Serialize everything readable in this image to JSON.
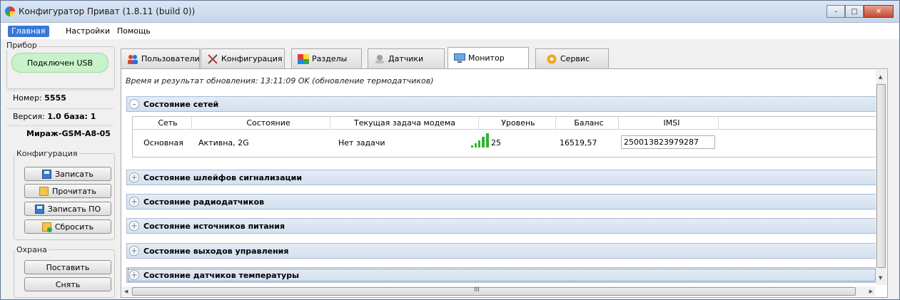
{
  "window": {
    "title": "Конфигуратор Приват (1.8.11 (build 0))"
  },
  "menu": {
    "items": [
      "Главная",
      "Настройки",
      "Помощь"
    ]
  },
  "sidebar": {
    "device_group": "Прибор",
    "usb_status": "Подключен USB",
    "number_label": "Номер:",
    "number_value": "5555",
    "version_label": "Версия:",
    "version_value": "1.0 база: 1",
    "model": "Мираж-GSM-A8-05",
    "config_group": "Конфигурация",
    "config_buttons": [
      "Записать",
      "Прочитать",
      "Записать ПО",
      "Сбросить"
    ],
    "guard_group": "Охрана",
    "guard_buttons": [
      "Поставить",
      "Снять"
    ]
  },
  "tabs": [
    "Пользователи",
    "Конфигурация",
    "Разделы",
    "Датчики",
    "Монитор",
    "Сервис"
  ],
  "active_tab": "Монитор",
  "monitor": {
    "update_status": "Время и результат обновления: 13:11:09 OK (обновление термодатчиков)",
    "sections": [
      "Состояние сетей",
      "Состояние шлейфов сигнализации",
      "Состояние радиодатчиков",
      "Состояние источников питания",
      "Состояние выходов управления",
      "Состояние датчиков температуры"
    ],
    "network_table": {
      "columns": [
        "Сеть",
        "Состояние",
        "Текущая задача модема",
        "Уровень",
        "Баланс",
        "IMSI"
      ],
      "row": {
        "network": "Основная",
        "state": "Активна, 2G",
        "task": "Нет задачи",
        "level": "25",
        "balance": "16519,57",
        "imsi": "250013823979287"
      }
    },
    "hscroll_marker": "III"
  },
  "colors": {
    "accent": "#3a78d6",
    "usb_ok": "#c8f2c8",
    "signal": "#2fb52f",
    "section_bg": "#dbe6f2"
  }
}
